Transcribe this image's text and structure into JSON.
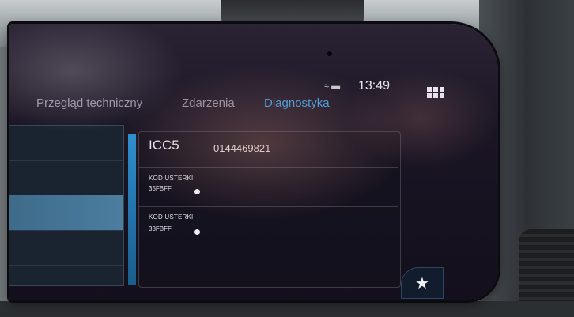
{
  "status": {
    "time": "13:49",
    "icons": [
      "wifi-icon",
      "battery-icon"
    ]
  },
  "tabs": [
    {
      "label": "Przegląd techniczny",
      "active": false
    },
    {
      "label": "Zdarzenia",
      "active": false
    },
    {
      "label": "Diagnostyka",
      "active": true
    }
  ],
  "card": {
    "title": "ICC5",
    "id": "0144469821",
    "faults": [
      {
        "label": "KOD USTERKI",
        "code": "35FBFF"
      },
      {
        "label": "KOD USTERKI",
        "code": "33FBFF"
      }
    ]
  },
  "colors": {
    "accent": "#3fa0e6",
    "screen_bg": "#1a1524",
    "text": "#e6e6ee"
  },
  "icons": {
    "menu": "grid-icon",
    "favorite": "star-icon"
  }
}
